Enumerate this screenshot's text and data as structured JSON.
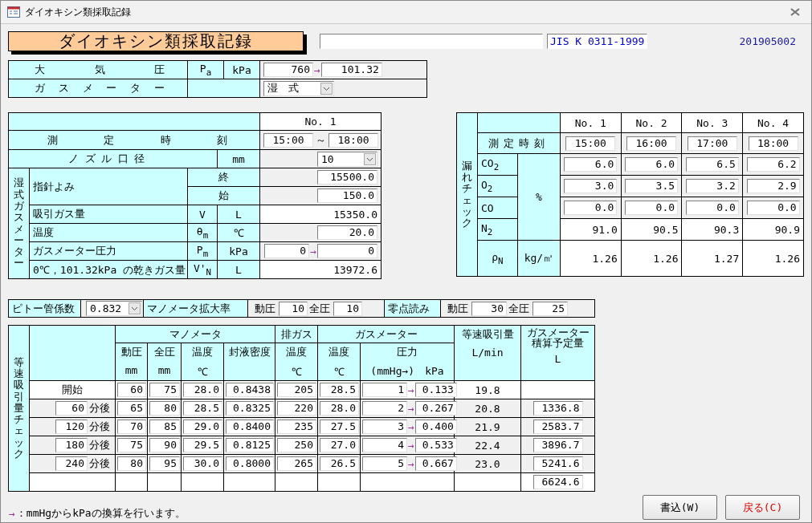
{
  "window": {
    "title": "ダイオキシン類採取記録"
  },
  "header": {
    "title": "ダイオキシン類採取記録",
    "standard": "JIS K 0311-1999",
    "record_no": "201905002"
  },
  "atmosphere": {
    "label": "大気圧",
    "symbol": "P$_{a}$",
    "unit": "kPa",
    "value_mmhg": "760",
    "arrow": "→",
    "value_kpa": "101.32"
  },
  "gas_meter": {
    "label": "ガスメーター",
    "type": "湿　式"
  },
  "measurement": {
    "column": "No. 1",
    "time_label": "測定時刻",
    "start": "15:00",
    "separator": "～",
    "end": "18:00",
    "nozzle_label": "ノズル口径",
    "nozzle_unit": "mm",
    "nozzle": "10",
    "group_label": "湿式ガスメーター",
    "reading_label": "指針よみ",
    "rows": [
      {
        "kind": "reading",
        "sub": "終",
        "value": "15500.0"
      },
      {
        "kind": "reading",
        "sub": "始",
        "value": "150.0"
      },
      {
        "kind": "computed",
        "label": "吸引ガス量",
        "symbol": "V",
        "unit": "L",
        "value": "15350.0"
      },
      {
        "kind": "field",
        "label": "温度",
        "symbol": "θ$_{m}$",
        "unit": "℃",
        "value": "20.0"
      },
      {
        "kind": "pressure",
        "label": "ガスメーター圧力",
        "symbol": "P$_{m}$",
        "unit": "kPa",
        "value_mmhg": "0",
        "arrow": "→",
        "value": "0"
      },
      {
        "kind": "computed",
        "label": "0℃，101.32kPa の乾きガス量",
        "symbol": "V'$_{N}$",
        "unit": "L",
        "value": "13972.6"
      }
    ]
  },
  "leak_check": {
    "label": "漏れチェック",
    "columns": [
      "No. 1",
      "No. 2",
      "No. 3",
      "No. 4"
    ],
    "time_label": "測定時刻",
    "times": [
      "15:00",
      "16:00",
      "17:00",
      "18:00"
    ],
    "unit": "%",
    "gases": [
      {
        "kind": "field",
        "label": "CO$_{2}$",
        "values": [
          "6.0",
          "6.0",
          "6.5",
          "6.2"
        ]
      },
      {
        "kind": "field",
        "label": "O$_{2}$",
        "values": [
          "3.0",
          "3.5",
          "3.2",
          "2.9"
        ]
      },
      {
        "kind": "field",
        "label": "CO",
        "values": [
          "0.0",
          "0.0",
          "0.0",
          "0.0"
        ]
      },
      {
        "kind": "computed",
        "label": "N$_{2}$",
        "values": [
          "91.0",
          "90.5",
          "90.3",
          "90.9"
        ]
      }
    ],
    "density": {
      "label": "ρ$_{N}$",
      "unit": "kg/㎥",
      "values": [
        "1.26",
        "1.26",
        "1.27",
        "1.26"
      ]
    }
  },
  "coefficients": {
    "pitot_label": "ピトー管係数",
    "pitot": "0.832",
    "manometer_label": "マノメータ拡大率",
    "manometer": [
      {
        "label": "動圧",
        "value": "10"
      },
      {
        "label": "全圧",
        "value": "10"
      }
    ],
    "zero_label": "零点読み",
    "zero": [
      {
        "label": "動圧",
        "value": "30"
      },
      {
        "label": "全圧",
        "value": "25"
      }
    ]
  },
  "isokinetic": {
    "label": "等速吸引量チェック",
    "manometer": "マノメータ",
    "exhaust": "排ガス",
    "gas_meter": "ガスメーター",
    "rate": "等速吸引量",
    "rate_unit": "L/min",
    "planned": [
      "ガスメーター",
      "積算予定量"
    ],
    "planned_unit": "L",
    "columns": [
      {
        "label": "動圧",
        "unit": "mm"
      },
      {
        "label": "全圧",
        "unit": "mm"
      },
      {
        "label": "温度",
        "unit": "℃"
      },
      {
        "label": "封液密度"
      },
      {
        "label": "温度",
        "unit": "℃"
      },
      {
        "label": "温度",
        "unit": "℃"
      },
      {
        "label": "圧力",
        "unit": "(mmHg→)　kPa"
      }
    ],
    "rows": [
      {
        "kind": "start",
        "label": "開始",
        "values": [
          "60",
          "75",
          "28.0",
          "0.8438",
          "205",
          "28.5"
        ],
        "mmhg": "1",
        "arrow": "→",
        "kpa": "0.133",
        "rate": "19.8"
      },
      {
        "kind": "after",
        "minutes": "60",
        "suffix": "分後",
        "values": [
          "65",
          "80",
          "28.5",
          "0.8325",
          "220",
          "28.0"
        ],
        "mmhg": "2",
        "arrow": "→",
        "kpa": "0.267",
        "rate": "20.8",
        "planned": "1336.8"
      },
      {
        "kind": "after",
        "minutes": "120",
        "suffix": "分後",
        "values": [
          "70",
          "85",
          "29.0",
          "0.8400",
          "235",
          "27.5"
        ],
        "mmhg": "3",
        "arrow": "→",
        "kpa": "0.400",
        "rate": "21.9",
        "planned": "2583.7"
      },
      {
        "kind": "after",
        "minutes": "180",
        "suffix": "分後",
        "values": [
          "75",
          "90",
          "29.5",
          "0.8125",
          "250",
          "27.0"
        ],
        "mmhg": "4",
        "arrow": "→",
        "kpa": "0.533",
        "rate": "22.4",
        "planned": "3896.7"
      },
      {
        "kind": "after",
        "minutes": "240",
        "suffix": "分後",
        "values": [
          "80",
          "95",
          "30.0",
          "0.8000",
          "265",
          "26.5"
        ],
        "mmhg": "5",
        "arrow": "→",
        "kpa": "0.667",
        "rate": "23.0",
        "planned": "5241.6"
      }
    ],
    "total": "6624.6"
  },
  "note": {
    "arrow": "→",
    "text": "：mmHgからkPaの換算を行います。"
  },
  "buttons": [
    {
      "kind": "write",
      "label": "書込(W)"
    },
    {
      "kind": "back",
      "label": "戻る(C)"
    }
  ]
}
